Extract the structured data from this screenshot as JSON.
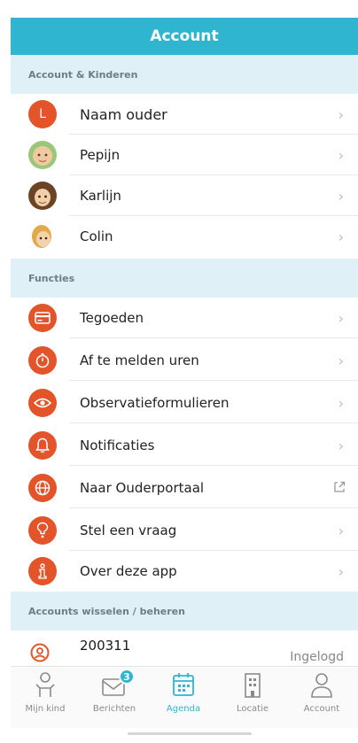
{
  "header": {
    "title": "Account"
  },
  "sections": {
    "account": "Account & Kinderen",
    "functions": "Functies",
    "switch": "Accounts wisselen / beheren"
  },
  "parent": {
    "initial": "L",
    "name": "Naam ouder"
  },
  "children": [
    {
      "name": "Pepijn"
    },
    {
      "name": "Karlijn"
    },
    {
      "name": "Colin"
    }
  ],
  "functions": [
    {
      "label": "Tegoeden",
      "icon": "credit-card-icon"
    },
    {
      "label": "Af te melden uren",
      "icon": "stopwatch-icon"
    },
    {
      "label": "Observatieformulieren",
      "icon": "eye-icon"
    },
    {
      "label": "Notificaties",
      "icon": "bell-icon"
    },
    {
      "label": "Naar Ouderportaal",
      "icon": "globe-icon",
      "external": true
    },
    {
      "label": "Stel een vraag",
      "icon": "question-icon"
    },
    {
      "label": "Over deze app",
      "icon": "info-icon"
    }
  ],
  "account_entry": {
    "id": "200311",
    "status": "Ingelogd"
  },
  "tabs": [
    {
      "label": "Mijn kind",
      "icon": "child-icon"
    },
    {
      "label": "Berichten",
      "icon": "messages-icon",
      "badge": "3"
    },
    {
      "label": "Agenda",
      "icon": "calendar-icon",
      "active": true
    },
    {
      "label": "Locatie",
      "icon": "building-icon"
    },
    {
      "label": "Account",
      "icon": "user-icon"
    }
  ],
  "colors": {
    "accent": "#2fb5cf",
    "icon_bg": "#e3542a",
    "section_bg": "#dff0f6"
  }
}
